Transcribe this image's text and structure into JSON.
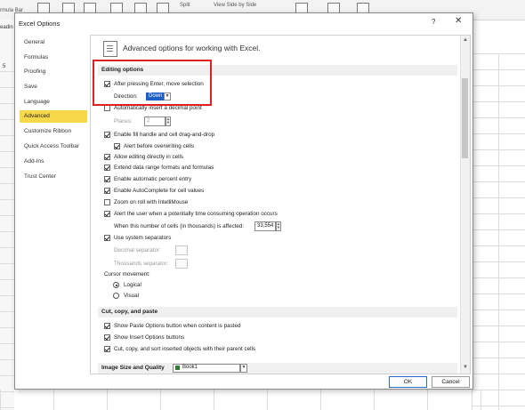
{
  "background": {
    "formula_bar_label": "rmula Bar",
    "left_label": "eadin",
    "row_number": "5",
    "ribbon_split": "Split",
    "ribbon_side_by_side": "View Side by Side"
  },
  "dialog": {
    "title": "Excel Options",
    "help_glyph": "?",
    "close_glyph": "✕"
  },
  "nav": {
    "items": [
      {
        "label": "General"
      },
      {
        "label": "Formulas"
      },
      {
        "label": "Proofing"
      },
      {
        "label": "Save"
      },
      {
        "label": "Language"
      },
      {
        "label": "Advanced",
        "active": true
      },
      {
        "label": "Customize Ribbon"
      },
      {
        "label": "Quick Access Toolbar"
      },
      {
        "label": "Add-Ins"
      },
      {
        "label": "Trust Center"
      }
    ]
  },
  "header": {
    "title": "Advanced options for working with Excel."
  },
  "editing": {
    "section_title": "Editing options",
    "after_enter": "After pressing Enter, move selection",
    "direction_label": "Direction:",
    "direction_value": "Down",
    "decimal_point": "Automatically insert a decimal point",
    "places_label": "Places:",
    "places_value": "2",
    "fill_handle": "Enable fill handle and cell drag-and-drop",
    "alert_overwrite": "Alert before overwriting cells",
    "edit_in_cells": "Allow editing directly in cells",
    "extend_formats": "Extend data range formats and formulas",
    "auto_percent": "Enable automatic percent entry",
    "autocomplete": "Enable AutoComplete for cell values",
    "zoom_roll": "Zoom on roll with IntelliMouse",
    "alert_time": "Alert the user when a potentially time consuming operation occurs",
    "cells_affected_label": "When this number of cells (in thousands) is affected:",
    "cells_affected_value": "33,554",
    "system_separators": "Use system separators",
    "decimal_separator": "Decimal separator:",
    "thousands_separator": "Thousands separator:",
    "cursor_movement": "Cursor movement:",
    "logical": "Logical",
    "visual": "Visual"
  },
  "cutcopy": {
    "section_title": "Cut, copy, and paste",
    "paste_options": "Show Paste Options button when content is pasted",
    "insert_options": "Show Insert Options buttons",
    "cut_copy_sort": "Cut, copy, and sort inserted objects with their parent cells"
  },
  "image": {
    "section_title": "Image Size and Quality",
    "workbook_value": "Book1"
  },
  "footer": {
    "ok": "OK",
    "cancel": "Cancel"
  }
}
